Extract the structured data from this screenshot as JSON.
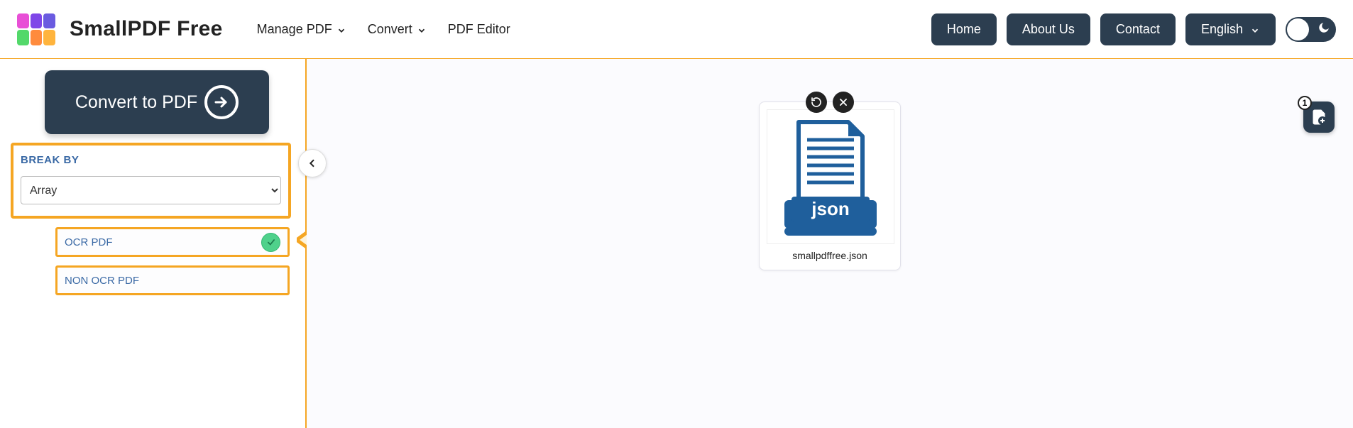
{
  "brand": "SmallPDF Free",
  "logo_colors": [
    "#e84fd6",
    "#7f46e8",
    "#6a5be0",
    "#53d86a",
    "#ff8b3d",
    "#ffb43d"
  ],
  "nav": [
    {
      "label": "Manage PDF",
      "has_dropdown": true
    },
    {
      "label": "Convert",
      "has_dropdown": true
    },
    {
      "label": "PDF Editor",
      "has_dropdown": false
    }
  ],
  "header_buttons": [
    "Home",
    "About Us",
    "Contact"
  ],
  "language": "English",
  "cta_label": "Convert to PDF",
  "break_by": {
    "label": "BREAK BY",
    "selected": "Array"
  },
  "options": [
    {
      "label": "OCR PDF",
      "checked": true
    },
    {
      "label": "NON OCR PDF",
      "checked": false
    }
  ],
  "file": {
    "name": "smallpdffree.json",
    "type_label": "json"
  },
  "add_widget_count": "1"
}
